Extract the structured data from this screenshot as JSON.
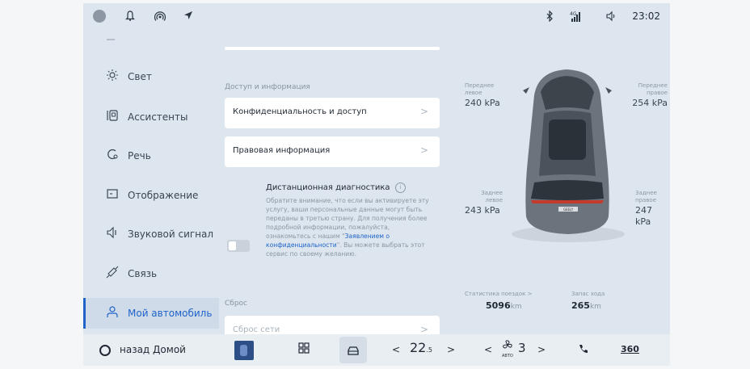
{
  "status_bar": {
    "icons": [
      "avatar-icon",
      "bell-icon",
      "hotspot-icon",
      "location-arrow-icon",
      "bluetooth-icon",
      "signal-4g-icon",
      "volume-icon"
    ],
    "network": "4G",
    "time": "23:02"
  },
  "sidebar": {
    "items": [
      {
        "label": "Свет",
        "icon": "sun-icon"
      },
      {
        "label": "Ассистенты",
        "icon": "assistant-icon"
      },
      {
        "label": "Речь",
        "icon": "speech-icon"
      },
      {
        "label": "Отображение",
        "icon": "display-icon"
      },
      {
        "label": "Звуковой сигнал",
        "icon": "sound-icon"
      },
      {
        "label": "Связь",
        "icon": "link-icon"
      },
      {
        "label": "Мой автомобиль",
        "icon": "person-icon",
        "active": true
      }
    ]
  },
  "content": {
    "section_access": "Доступ и информация",
    "privacy_card": "Конфиденциальность и доступ",
    "legal_card": "Правовая информация",
    "remote_diag": {
      "title": "Дистанционная диагностика",
      "text_before_link": "Обратите внимание, что если вы активируете эту услугу, ваши персональные данные могут быть переданы в третью страну. Для получения более подробной информации, пожалуйста, ознакомьтесь с нашим \"",
      "link": "Заявлением о конфиденциальности",
      "text_after_link": "\". Вы можете выбрать этот сервис по своему желанию.",
      "toggle_on": false
    },
    "section_reset": "Сброс",
    "reset_network": "Сброс сети"
  },
  "car": {
    "front_left": {
      "label_line1": "Переднее",
      "label_line2": "левое",
      "value": "240 kPa"
    },
    "front_right": {
      "label_line1": "Переднее",
      "label_line2": "правое",
      "value": "254 kPa"
    },
    "rear_left": {
      "label_line1": "Заднее",
      "label_line2": "левое",
      "value": "243 kPa"
    },
    "rear_right": {
      "label_line1": "Заднее",
      "label_line2": "правое",
      "value": "247 kPa"
    },
    "trip_stats_label": "Статистика поездок >",
    "trip_value": "5096",
    "trip_unit": "km",
    "range_label": "Запас хода",
    "range_value": "265",
    "range_unit": "km",
    "badge": "GEELY"
  },
  "dock": {
    "home_label": "назад Домой",
    "temp_left": "22",
    "temp_left_decimal": ".5",
    "fan_mode": "АВТО",
    "fan_level": "3",
    "view_360": "360",
    "chev_left": "<",
    "chev_right": ">"
  },
  "colors": {
    "accent": "#1f63c9",
    "background": "#dde6ef",
    "card": "#ffffff"
  }
}
